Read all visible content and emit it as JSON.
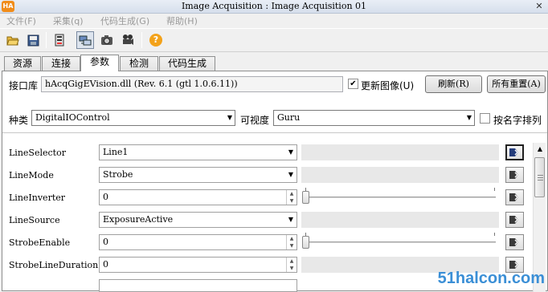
{
  "window": {
    "title": "Image Acquisition : Image Acquisition 01",
    "app_icon": "HA",
    "close_glyph": "✕"
  },
  "menu": [
    {
      "label": "文件(F)"
    },
    {
      "label": "采集(q)"
    },
    {
      "label": "代码生成(G)"
    },
    {
      "label": "帮助(H)"
    }
  ],
  "toolbar": {
    "help_glyph": "?"
  },
  "tabs": [
    {
      "label": "资源"
    },
    {
      "label": "连接"
    },
    {
      "label": "参数"
    },
    {
      "label": "检测"
    },
    {
      "label": "代码生成"
    }
  ],
  "interface": {
    "label": "接口库",
    "value": "hAcqGigEVision.dll (Rev. 6.1 (gtl 1.0.6.11))",
    "update_image_label": "更新图像(U)",
    "update_image_checked": true,
    "refresh_label": "刷新(R)",
    "reset_all_label": "所有重置(A)"
  },
  "filter": {
    "category_label": "种类",
    "category_value": "DigitalIOControl",
    "visibility_label": "可视度",
    "visibility_value": "Guru",
    "sort_by_name_label": "按名字排列",
    "sort_by_name_checked": false
  },
  "params": [
    {
      "name": "LineSelector",
      "value": "Line1"
    },
    {
      "name": "LineMode",
      "value": "Strobe"
    },
    {
      "name": "LineInverter",
      "value": "0"
    },
    {
      "name": "LineSource",
      "value": "ExposureActive"
    },
    {
      "name": "StrobeEnable",
      "value": "0"
    },
    {
      "name": "StrobeLineDuration",
      "value": "0"
    }
  ],
  "watermark": "51halcon.com"
}
